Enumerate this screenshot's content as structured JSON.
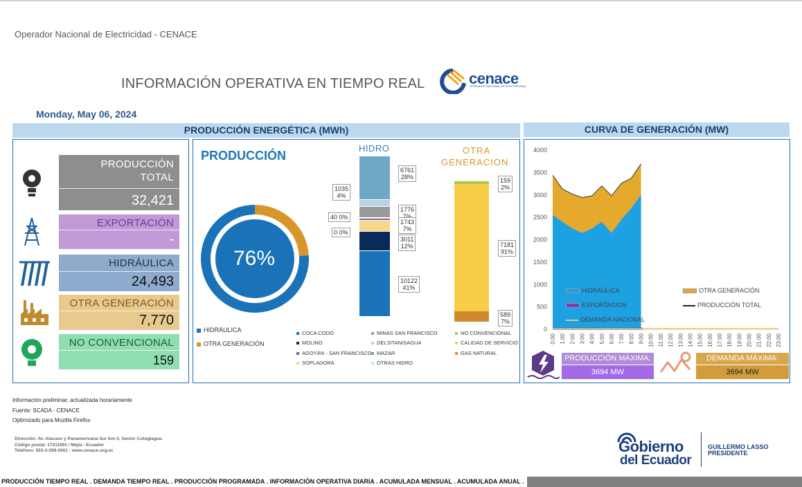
{
  "header": {
    "org": "Operador Nacional de Electricidad - CENACE",
    "title": "INFORMACIÓN OPERATIVA EN TIEMPO REAL",
    "logo_text": "cenace",
    "logo_sub": "OPERADOR NACIONAL DE ELECTRICIDAD",
    "date": "Monday, May 06, 2024"
  },
  "left_panel": {
    "title": "PRODUCCIÓN ENERGÉTICA (MWh)",
    "stats": [
      {
        "label": "PRODUCCIÓN TOTAL",
        "value": "32,421",
        "color": "#8e8e8e",
        "icon": "lightbulb-gear-icon"
      },
      {
        "label": "EXPORTACIÓN",
        "value": "-",
        "color": "#c099d6",
        "icon": "transmission-tower-icon"
      },
      {
        "label": "HIDRÁULICA",
        "value": "24,493",
        "color": "#8eaacc",
        "icon": "dam-icon"
      },
      {
        "label": "OTRA GENERACIÓN",
        "value": "7,770",
        "color": "#e8c98e",
        "icon": "factory-icon"
      },
      {
        "label": "NO CONVENCIONAL",
        "value": "159",
        "color": "#8fddb0",
        "icon": "green-bulb-icon"
      }
    ]
  },
  "produccion": {
    "title": "PRODUCCIÓN",
    "donut_pct": "76%",
    "donut_fraction": 0.76,
    "legend": [
      "HIDRÁULICA",
      "OTRA GENERACIÓN"
    ],
    "hidro_title": "HIDRO",
    "otra_title_1": "OTRA",
    "otra_title_2": "GENERACION",
    "hidro_segments": [
      {
        "value": "6761",
        "pct": "28%",
        "color": "#6fa8c4"
      },
      {
        "value": "1035",
        "pct": "4%",
        "color": "#b9d3e0"
      },
      {
        "value": "1776",
        "pct": "7%",
        "color": "#9a9a9a"
      },
      {
        "value": "40",
        "pct": "0%",
        "color": "#7d5ba6"
      },
      {
        "value": "1743",
        "pct": "7%",
        "color": "#f5d88a"
      },
      {
        "value": "0",
        "pct": "0%",
        "color": "#cce3ef"
      },
      {
        "value": "3011",
        "pct": "12%",
        "color": "#0b2a5c"
      },
      {
        "value": "10122",
        "pct": "41%",
        "color": "#1a73b8"
      }
    ],
    "otra_segments": [
      {
        "value": "159",
        "pct": "2%",
        "color": "#a8c84a"
      },
      {
        "value": "7181",
        "pct": "91%",
        "color": "#f8cd48"
      },
      {
        "value": "589",
        "pct": "7%",
        "color": "#cf8a2e"
      }
    ],
    "plant_legend": [
      {
        "label": "COCA CODO",
        "color": "#1a73b8"
      },
      {
        "label": "MINAS SAN FRANCISCO",
        "color": "#9a9a9a"
      },
      {
        "label": "NO CONVENCIONAL",
        "color": "#a8c84a"
      },
      {
        "label": "MOLINO",
        "color": "#0b2a5c"
      },
      {
        "label": "DELSITANISAGUA",
        "color": "#b9d3e0"
      },
      {
        "label": "CALIDAD DE SERVICIO",
        "color": "#f8cd48"
      },
      {
        "label": "AGOYÁN - SAN FRANCISCO",
        "color": "#7d5ba6"
      },
      {
        "label": "MAZAR",
        "color": "#6fa8c4"
      },
      {
        "label": "GAS NATURAL",
        "color": "#cf8a2e"
      },
      {
        "label": "SOPLADORA",
        "color": "#f5d88a"
      },
      {
        "label": "OTRAS HIDRO",
        "color": "#cce3ef"
      }
    ]
  },
  "curve_panel": {
    "title": "CURVA DE GENERACIÓN (MW)",
    "legend": [
      {
        "label": "HIDRAÚLICA",
        "color": "#1da1e2"
      },
      {
        "label": "OTRA GENERACIÓN",
        "color": "#e5a92e"
      },
      {
        "label": "EXPORTACION",
        "color": "#7c3eb5"
      },
      {
        "label": "PRODUCCIÓN TOTAL",
        "color": "#222222"
      },
      {
        "label": "DEMANDA NACIONAL",
        "color": "#f5c36a"
      }
    ],
    "max_prod_label": "PRODUCCIÓN MÁXIMA:",
    "max_prod_value": "3694 MW",
    "max_dem_label": "DEMANDA MÁXIMA:",
    "max_dem_value": "3694 MW"
  },
  "chart_data": {
    "type": "area",
    "title": "",
    "xlabel": "",
    "ylabel": "",
    "categories": [
      "0:00",
      "1:00",
      "2:00",
      "3:00",
      "4:00",
      "5:00",
      "6:00",
      "7:00",
      "8:00",
      "9:00",
      "10:00",
      "11:00",
      "12:00",
      "13:00",
      "14:00",
      "15:00",
      "16:00",
      "17:00",
      "18:00",
      "19:00",
      "20:00",
      "21:00",
      "22:00",
      "23:00"
    ],
    "yticks": [
      4000,
      3500,
      3000,
      2500,
      2000,
      1500,
      1000,
      500,
      0
    ],
    "ylim": [
      0,
      4000
    ],
    "series": [
      {
        "name": "HIDRAÚLICA",
        "values": [
          2550,
          2400,
          2250,
          2150,
          2250,
          2400,
          2150,
          2450,
          2700,
          3000
        ]
      },
      {
        "name": "OTRA GENERACIÓN",
        "values": [
          890,
          730,
          770,
          790,
          730,
          800,
          830,
          810,
          670,
          694
        ]
      },
      {
        "name": "PRODUCCIÓN TOTAL",
        "values": [
          3440,
          3130,
          3020,
          2940,
          2980,
          3200,
          2980,
          3260,
          3370,
          3694
        ]
      },
      {
        "name": "DEMANDA NACIONAL",
        "values": [
          0,
          0,
          0,
          0,
          0,
          0,
          0,
          0,
          0,
          0,
          0,
          0,
          0,
          0,
          0,
          0,
          0,
          0,
          0,
          0,
          0,
          0,
          0,
          0
        ]
      }
    ]
  },
  "footer": {
    "note1": "Información preliminar, actualizada horariamente",
    "note2": "Fuente: SCADA - CENACE",
    "note3": "Optimizado para Mozilla Firefox",
    "addr1": "Dirección: Av. Atacazo y Panamericana Sur Km 0, Sector Cutuglagua.",
    "addr2": "Código postal: 17211991 / Mejía - Ecuador",
    "addr3": "Teléfono: 593-2-299-2001 - www.cenace.org.ec",
    "gob1": "Gobierno",
    "gob2": "del Ecuador",
    "pres1": "GUILLERMO LASSO",
    "pres2": "PRESIDENTE",
    "links": [
      "PRODUCCIÓN TIEMPO REAL",
      "DEMANDA TIEMPO REAL",
      "PRODUCCIÓN PROGRAMADA",
      "INFORMACIÓN OPERATIVA DIARIA",
      "ACUMULADA MENSUAL",
      "ACUMULADA ANUAL"
    ]
  }
}
